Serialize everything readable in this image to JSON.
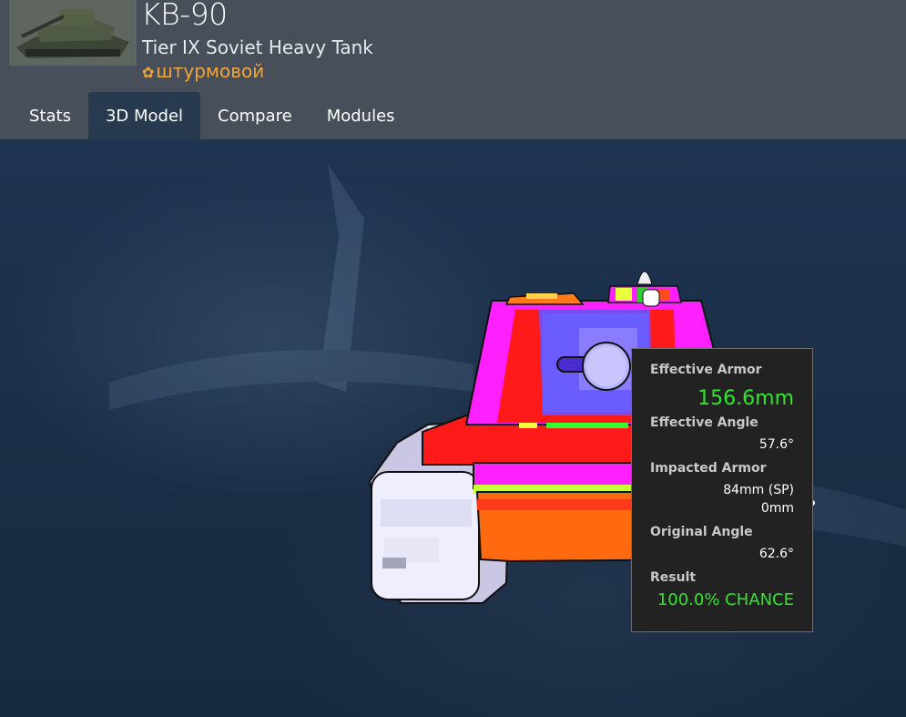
{
  "header": {
    "title": "KB-90",
    "subtitle": "Tier IX Soviet Heavy Tank",
    "role_icon": "✿",
    "role": "штурмовой",
    "thumbnail": "tank-thumbnail-icon"
  },
  "tabs": [
    {
      "label": "Stats",
      "active": false
    },
    {
      "label": "3D Model",
      "active": true
    },
    {
      "label": "Compare",
      "active": false
    },
    {
      "label": "Modules",
      "active": false
    }
  ],
  "tooltip": {
    "effective_armor_label": "Effective Armor",
    "effective_armor_value": "156.6mm",
    "effective_angle_label": "Effective Angle",
    "effective_angle_value": "57.6°",
    "impacted_armor_label": "Impacted Armor",
    "impacted_armor_value_1": "84mm (SP)",
    "impacted_armor_value_2": "0mm",
    "original_angle_label": "Original Angle",
    "original_angle_value": "62.6°",
    "result_label": "Result",
    "result_value": "100.0% CHANCE"
  },
  "colors": {
    "header_bg": "#464f5a",
    "active_tab_bg": "#283a50",
    "viewport_bg": "#1b2d44",
    "role_color": "#f3a536",
    "good_green": "#2ee62a",
    "armor_magenta": "#ff20ff",
    "armor_red": "#ff1a1a",
    "armor_blue": "#6a5cff"
  }
}
